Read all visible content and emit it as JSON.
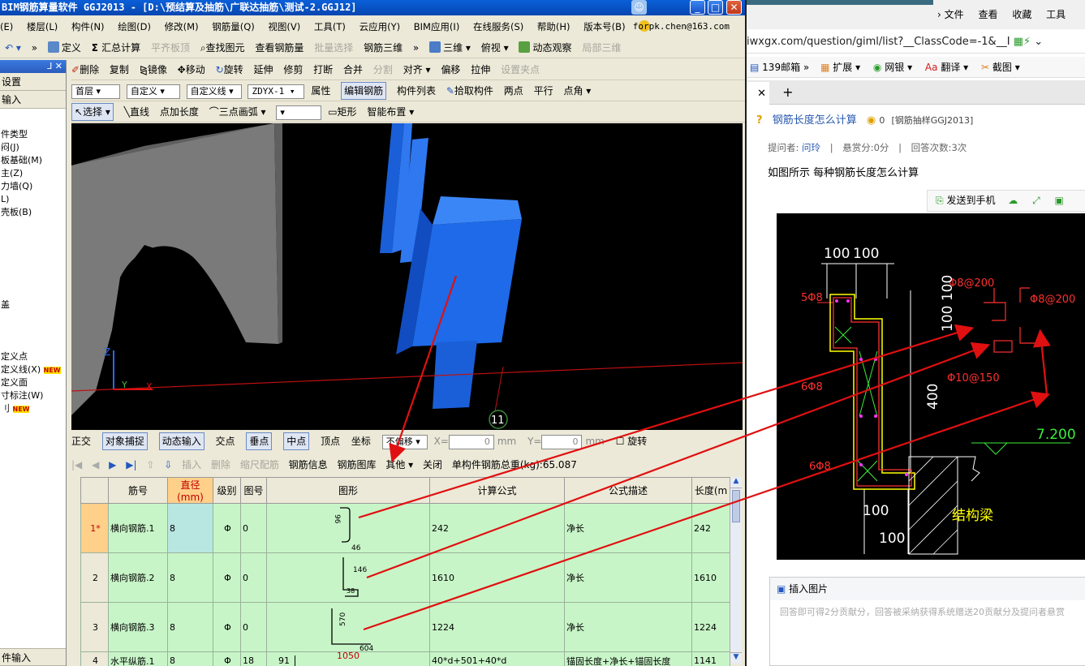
{
  "window": {
    "title": "BIM钢筋算量软件 GGJ2013 - [D:\\预结算及抽筋\\广联达抽筋\\测试-2.GGJ12]",
    "min_glyph": "_",
    "max_glyph": "□",
    "close_glyph": "✕"
  },
  "menu": {
    "items": [
      "(E)",
      "楼层(L)",
      "构件(N)",
      "绘图(D)",
      "修改(M)",
      "钢筋量(Q)",
      "视图(V)",
      "工具(T)",
      "云应用(Y)",
      "BIM应用(I)",
      "在线服务(S)",
      "帮助(H)",
      "版本号(B)"
    ],
    "user": "forpk.chen@163.com"
  },
  "toolbar1": {
    "define": "定义",
    "summary": "汇总计算",
    "flat_board": "平齐板顶",
    "find_element": "查找图元",
    "view_rebar": "查看钢筋量",
    "batch_select": "批量选择",
    "rebar_3d": "钢筋三维",
    "view_3d": "三维",
    "top_view": "俯视",
    "dynamic_view": "动态观察",
    "local_3d": "局部三维"
  },
  "toolbar2": {
    "delete": "删除",
    "copy": "复制",
    "mirror": "镜像",
    "move": "移动",
    "rotate": "旋转",
    "extend": "延伸",
    "trim": "修剪",
    "break": "打断",
    "merge": "合并",
    "split": "分割",
    "align": "对齐",
    "offset": "偏移",
    "stretch": "拉伸",
    "set_clip": "设置夹点"
  },
  "toolbar3": {
    "floor": "首层",
    "custom": "自定义",
    "custom_line": "自定义线",
    "code": "ZDYX-1",
    "property": "属性",
    "edit_rebar": "编辑钢筋",
    "element_list": "构件列表",
    "pick_element": "拾取构件",
    "two_points": "两点",
    "parallel": "平行",
    "point_angle": "点角"
  },
  "toolbar4": {
    "select": "选择",
    "line": "直线",
    "point_length": "点加长度",
    "arc3": "三点画弧",
    "rect": "矩形",
    "smart_layout": "智能布置"
  },
  "left_panel": {
    "pin": "ᒧ ✕",
    "tabs": [
      "设置",
      "输入"
    ],
    "items": [
      "件类型",
      "闷(J)",
      "板基础(M)",
      "主(Z)",
      "力墙(Q)",
      "L)",
      "壳板(B)",
      "盖",
      "定义点",
      "定义线(X)",
      "定义面",
      "寸标注(W)",
      "刂"
    ],
    "new_badge": "NEW",
    "bottom": "件输入"
  },
  "viewport": {
    "axis_z": "Z",
    "axis_y": "Y",
    "axis_x": "X",
    "grid_marker": "11"
  },
  "snapbar": {
    "ortho": "正交",
    "snap": "对象捕捉",
    "dynamic_input": "动态输入",
    "intersect": "交点",
    "perpendicular": "垂点",
    "midpoint": "中点",
    "vertex": "顶点",
    "coord": "坐标",
    "no_offset": "不偏移",
    "x_label": "X=",
    "x_val": "0",
    "y_label": "Y=",
    "y_val": "0",
    "unit": "mm",
    "rotate": "旋转"
  },
  "rebarbar": {
    "insert": "插入",
    "delete": "删除",
    "scale_rebar": "缩尺配筋",
    "rebar_info": "钢筋信息",
    "rebar_library": "钢筋图库",
    "other": "其他",
    "close": "关闭",
    "total_label": "单构件钢筋总重(kg):65.087"
  },
  "table": {
    "headers": [
      "",
      "筋号",
      "直径(mm)",
      "级别",
      "图号",
      "图形",
      "计算公式",
      "公式描述",
      "长度(m"
    ],
    "rows": [
      {
        "idx": "1*",
        "name": "横向钢筋.1",
        "dia": "8",
        "grade": "Φ",
        "fig": "0",
        "formula": "242",
        "desc": "净长",
        "len": "242",
        "shape_a": "96",
        "shape_b": "46"
      },
      {
        "idx": "2",
        "name": "横向钢筋.2",
        "dia": "8",
        "grade": "Φ",
        "fig": "0",
        "formula": "1610",
        "desc": "净长",
        "len": "1610",
        "shape_a": "146",
        "shape_b": "38"
      },
      {
        "idx": "3",
        "name": "横向钢筋.3",
        "dia": "8",
        "grade": "Φ",
        "fig": "0",
        "formula": "1224",
        "desc": "净长",
        "len": "1224",
        "shape_a": "570",
        "shape_b": "604"
      },
      {
        "idx": "4",
        "name": "水平纵筋.1",
        "dia": "8",
        "grade": "Φ",
        "fig": "18",
        "formula": "40*d+501+40*d",
        "desc": "锚固长度+净长+锚固长度",
        "len": "1141",
        "shape_a": "91",
        "shape_b": "1050"
      }
    ]
  },
  "browser": {
    "menu": [
      "文件",
      "查看",
      "收藏",
      "工具"
    ],
    "url": "iwxgx.com/question/giml/list?__ClassCode=-1&__I",
    "favorites": [
      "139邮箱",
      "扩展",
      "网银",
      "翻译",
      "截图"
    ],
    "tab_close": "✕",
    "tab_plus": "+",
    "question_title": "钢筋长度怎么计算",
    "question_points": "0",
    "question_tag": "[钢筋抽样GGJ2013]",
    "meta_asker_label": "提问者:",
    "meta_asker": "问玲",
    "meta_reward": "悬赏分:0分",
    "meta_answers": "回答次数:3次",
    "question_text": "如图所示  每种钢筋长度怎么计算",
    "send_to_phone": "发送到手机",
    "insert_image": "插入图片",
    "answer_placeholder": "回答即可得2分贡献分，回答被采纳获得系统赠送20贡献分及提问者悬赏"
  },
  "cad": {
    "dim_100a": "100",
    "dim_100b": "100",
    "label_5phi8": "5Φ8",
    "label_phi8_200a": "Φ8@200",
    "label_phi8_200b": "Φ8@200",
    "label_6phi8a": "6Φ8",
    "label_phi10_150": "Φ10@150",
    "dim_100_100": "100 100",
    "dim_400": "400",
    "level": "7.200",
    "label_6phi8b": "6Φ8",
    "dim_100c": "100",
    "dim_100d": "100",
    "beam": "结构梁"
  },
  "colors": {
    "accent_blue": "#0a5fd8",
    "grid_green": "#c8f5c8",
    "arrow_red": "#e01010",
    "cad_yellow": "#ffff00",
    "cad_red": "#ff3030",
    "cad_white": "#ffffff"
  }
}
